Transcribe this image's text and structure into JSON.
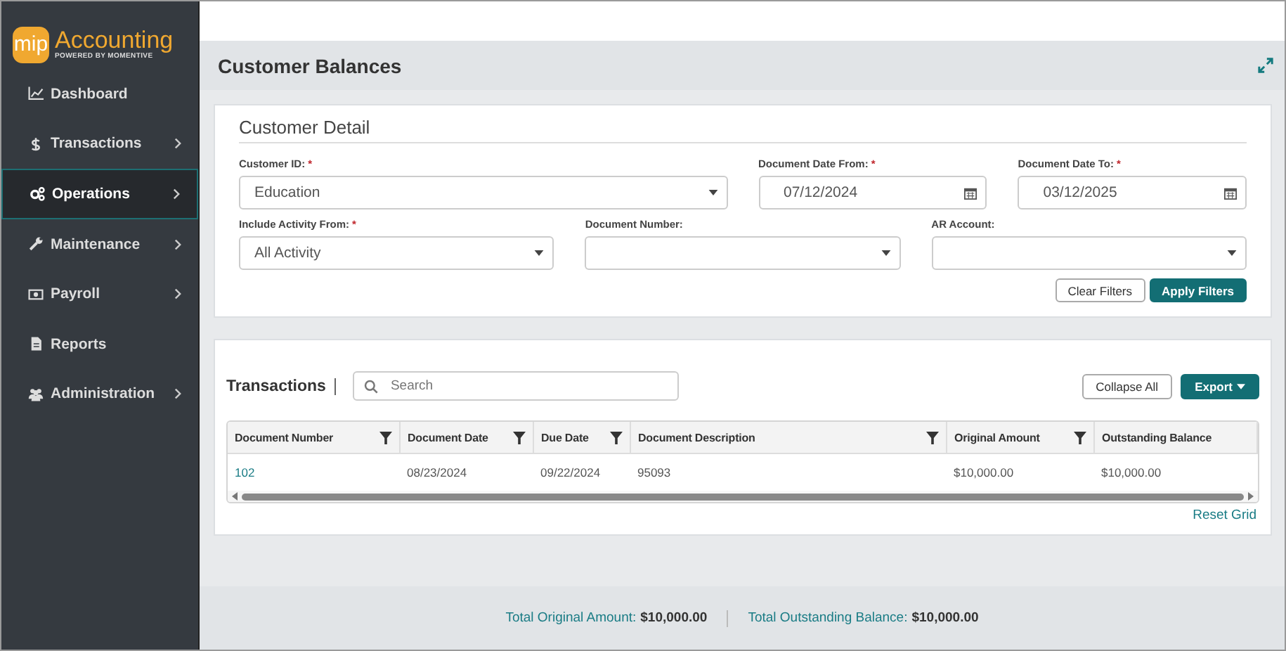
{
  "logo": {
    "badge": "mip",
    "name": "Accounting",
    "tagline": "POWERED BY MOMENTIVE"
  },
  "sidebar": {
    "items": [
      {
        "label": "Dashboard",
        "expandable": false,
        "selected": false
      },
      {
        "label": "Transactions",
        "expandable": true,
        "selected": false
      },
      {
        "label": "Operations",
        "expandable": true,
        "selected": true
      },
      {
        "label": "Maintenance",
        "expandable": true,
        "selected": false
      },
      {
        "label": "Payroll",
        "expandable": true,
        "selected": false
      },
      {
        "label": "Reports",
        "expandable": false,
        "selected": false
      },
      {
        "label": "Administration",
        "expandable": true,
        "selected": false
      }
    ]
  },
  "page_title": "Customer Balances",
  "customer_detail": {
    "title": "Customer Detail",
    "rows": [
      [
        {
          "label": "Customer ID:",
          "marker": "*",
          "kind": "select",
          "value": "Education"
        },
        {
          "label": "Document Date From:",
          "marker": "*",
          "kind": "date",
          "value": "07/12/2024"
        },
        {
          "label": "Document Date To:",
          "marker": "*",
          "kind": "date",
          "value": "03/12/2025"
        }
      ],
      [
        {
          "label": "Include Activity From:",
          "marker": "*",
          "kind": "select",
          "value": "All Activity"
        },
        {
          "label": "Document Number:",
          "kind": "select"
        },
        {
          "label": "AR Account:",
          "kind": "select"
        }
      ]
    ],
    "buttons": [
      {
        "label": "Clear Filters",
        "primary": false
      },
      {
        "label": "Apply Filters",
        "primary": true
      }
    ]
  },
  "transactions": {
    "title": "Transactions",
    "search": {
      "placeholder": "Search"
    },
    "buttons": [
      {
        "label": "Collapse All",
        "primary": false,
        "dropdown": false
      },
      {
        "label": "Export",
        "primary": true,
        "dropdown": true
      }
    ],
    "table": {
      "columns": [
        {
          "label": "Document Number",
          "filter": true
        },
        {
          "label": "Document Date",
          "filter": true
        },
        {
          "label": "Due Date",
          "filter": true
        },
        {
          "label": "Document Description",
          "filter": true
        },
        {
          "label": "Original Amount",
          "filter": true
        },
        {
          "label": "Outstanding Balance"
        }
      ],
      "rows": [
        {
          "cells": [
            "102",
            "08/23/2024",
            "09/22/2024",
            "95093",
            "$10,000.00",
            "$10,000.00"
          ]
        }
      ]
    },
    "reset_link": "Reset Grid"
  },
  "totals": [
    {
      "label": "Total Original Amount:",
      "value": "$10,000.00"
    },
    {
      "label": "Total Outstanding Balance:",
      "value": "$10,000.00"
    }
  ]
}
